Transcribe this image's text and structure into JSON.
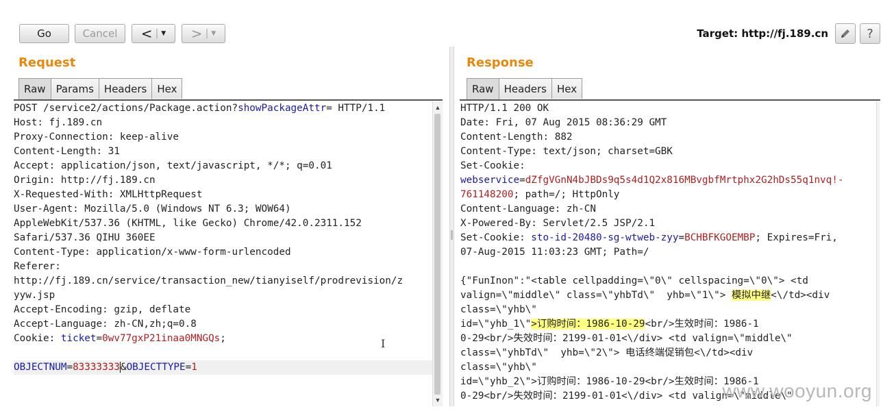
{
  "toolbar": {
    "go_label": "Go",
    "cancel_label": "Cancel",
    "back_glyph": "<",
    "forward_glyph": ">",
    "dropdown_glyph": "▼",
    "target_text": "Target: http://fj.189.cn",
    "edit_icon": "pencil-icon",
    "help_label": "?"
  },
  "request": {
    "title": "Request",
    "tabs": [
      "Raw",
      "Params",
      "Headers",
      "Hex"
    ],
    "active_tab": "Raw",
    "lines": [
      {
        "parts": [
          [
            "POST /service2/actions/Package.action?",
            ""
          ],
          [
            "showPackageAttr",
            "k"
          ],
          [
            "= HTTP/1.1",
            ""
          ]
        ]
      },
      {
        "parts": [
          [
            "Host: fj.189.cn",
            ""
          ]
        ]
      },
      {
        "parts": [
          [
            "Proxy-Connection: keep-alive",
            ""
          ]
        ]
      },
      {
        "parts": [
          [
            "Content-Length: 31",
            ""
          ]
        ]
      },
      {
        "parts": [
          [
            "Accept: application/json, text/javascript, */*; q=0.01",
            ""
          ]
        ]
      },
      {
        "parts": [
          [
            "Origin: http://fj.189.cn",
            ""
          ]
        ]
      },
      {
        "parts": [
          [
            "X-Requested-With: XMLHttpRequest",
            ""
          ]
        ]
      },
      {
        "parts": [
          [
            "User-Agent: Mozilla/5.0 (Windows NT 6.3; WOW64)",
            ""
          ]
        ]
      },
      {
        "parts": [
          [
            "AppleWebKit/537.36 (KHTML, like Gecko) Chrome/42.0.2311.152",
            ""
          ]
        ]
      },
      {
        "parts": [
          [
            "Safari/537.36 QIHU 360EE",
            ""
          ]
        ]
      },
      {
        "parts": [
          [
            "Content-Type: application/x-www-form-urlencoded",
            ""
          ]
        ]
      },
      {
        "parts": [
          [
            "Referer:",
            ""
          ]
        ]
      },
      {
        "parts": [
          [
            "http://fj.189.cn/service/transaction_new/tianyiself/prodrevision/z",
            ""
          ]
        ]
      },
      {
        "parts": [
          [
            "yyw.jsp",
            ""
          ]
        ]
      },
      {
        "parts": [
          [
            "Accept-Encoding: gzip, deflate",
            ""
          ]
        ]
      },
      {
        "parts": [
          [
            "Accept-Language: zh-CN,zh;q=0.8",
            ""
          ]
        ]
      },
      {
        "parts": [
          [
            "Cookie: ",
            ""
          ],
          [
            "ticket",
            "k"
          ],
          [
            "=",
            ""
          ],
          [
            "0wv77gxP21inaa0MNGQs",
            "v"
          ],
          [
            ";",
            ""
          ]
        ]
      },
      {
        "parts": [
          [
            "",
            ""
          ]
        ]
      },
      {
        "hl": true,
        "parts": [
          [
            "OBJECTNUM",
            "k"
          ],
          [
            "=",
            ""
          ],
          [
            "83333333",
            "v"
          ],
          [
            "&",
            "cursor"
          ],
          [
            "OBJECTTYPE",
            "k"
          ],
          [
            "=",
            ""
          ],
          [
            "1",
            "v"
          ]
        ]
      }
    ]
  },
  "response": {
    "title": "Response",
    "tabs": [
      "Raw",
      "Headers",
      "Hex"
    ],
    "active_tab": "Raw",
    "lines": [
      {
        "parts": [
          [
            "HTTP/1.1 200 OK",
            ""
          ]
        ]
      },
      {
        "parts": [
          [
            "Date: Fri, 07 Aug 2015 08:36:29 GMT",
            ""
          ]
        ]
      },
      {
        "parts": [
          [
            "Content-Length: 882",
            ""
          ]
        ]
      },
      {
        "parts": [
          [
            "Content-Type: text/json; charset=GBK",
            ""
          ]
        ]
      },
      {
        "parts": [
          [
            "Set-Cookie:",
            ""
          ]
        ]
      },
      {
        "parts": [
          [
            "webservice",
            "k"
          ],
          [
            "=",
            ""
          ],
          [
            "dZfgVGnN4bJBDs9q5s4d1Q2x816MBvgbfMrtphx2G2hDs55q1nvq!-",
            "v"
          ]
        ]
      },
      {
        "parts": [
          [
            "761148200",
            "v"
          ],
          [
            "; path=/; HttpOnly",
            ""
          ]
        ]
      },
      {
        "parts": [
          [
            "Content-Language: zh-CN",
            ""
          ]
        ]
      },
      {
        "parts": [
          [
            "X-Powered-By: Servlet/2.5 JSP/2.1",
            ""
          ]
        ]
      },
      {
        "parts": [
          [
            "Set-Cookie: ",
            ""
          ],
          [
            "sto-id-20480-sg-wtweb-zyy",
            "k"
          ],
          [
            "=",
            ""
          ],
          [
            "BCHBFKGOEMBP",
            "v"
          ],
          [
            "; Expires=Fri,",
            ""
          ]
        ]
      },
      {
        "parts": [
          [
            "07-Aug-2015 11:03:23 GMT; Path=/",
            ""
          ]
        ]
      },
      {
        "parts": [
          [
            "",
            ""
          ]
        ]
      },
      {
        "parts": [
          [
            "{\"FunInon\":\"<table cellpadding=\\\"0\\\" cellspacing=\\\"0\\\"> <td",
            ""
          ]
        ]
      },
      {
        "parts": [
          [
            "valign=\\\"middle\\\" class=\\\"yhbTd\\\"  yhb=\\\"1\\\"> ",
            ""
          ],
          [
            "模拟中继",
            "y"
          ],
          [
            "<\\/td><div",
            ""
          ]
        ]
      },
      {
        "parts": [
          [
            "class=\\\"yhb\\\"",
            ""
          ]
        ]
      },
      {
        "parts": [
          [
            "id=\\\"yhb_1\\\"",
            ""
          ],
          [
            ">订购时间：1986-10-29",
            "y"
          ],
          [
            "<br/>生效时间：1986-1",
            ""
          ]
        ]
      },
      {
        "parts": [
          [
            "0-29<br/>失效时间：2199-01-01<\\/div> <td valign=\\\"middle\\\"",
            ""
          ]
        ]
      },
      {
        "parts": [
          [
            "class=\\\"yhbTd\\\"  yhb=\\\"2\\\"> 电话终端促销包<\\/td><div",
            ""
          ]
        ]
      },
      {
        "parts": [
          [
            "class=\\\"yhb\\\"",
            ""
          ]
        ]
      },
      {
        "parts": [
          [
            "id=\\\"yhb_2\\\">订购时间：1986-10-29<br/>生效时间：1986-1",
            ""
          ]
        ]
      },
      {
        "parts": [
          [
            "0-29<br/>失效时间：2199-01-01<\\/div> <td valign=\\\"middle\\\"",
            ""
          ]
        ]
      }
    ]
  },
  "watermark": "www.wooyun.org"
}
